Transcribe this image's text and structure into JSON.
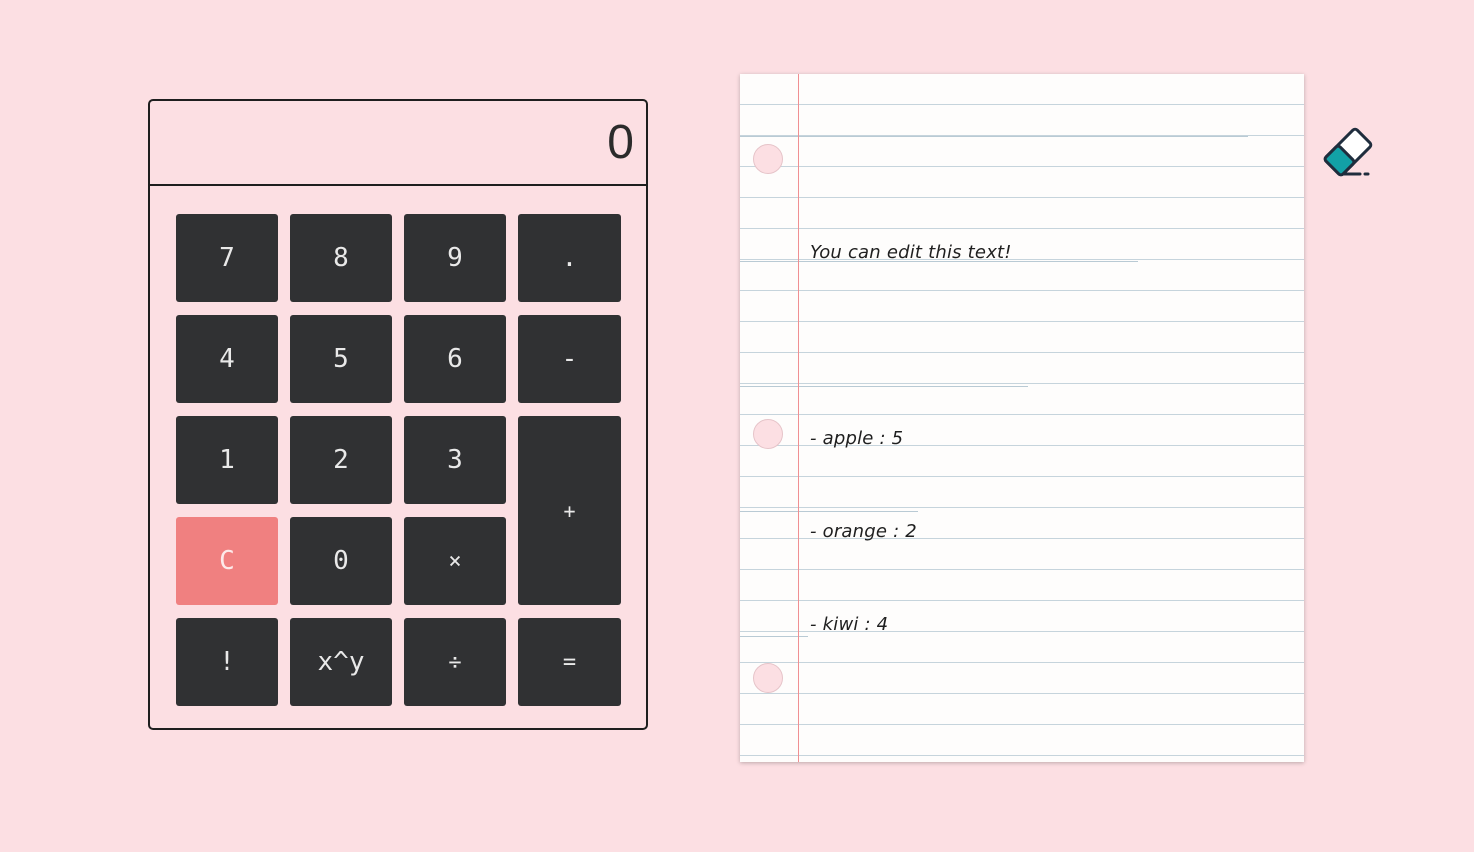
{
  "calculator": {
    "display": "0",
    "keys": [
      {
        "label": "7",
        "name": "key-7"
      },
      {
        "label": "8",
        "name": "key-8"
      },
      {
        "label": "9",
        "name": "key-9"
      },
      {
        "label": ".",
        "name": "key-decimal"
      },
      {
        "label": "4",
        "name": "key-4"
      },
      {
        "label": "5",
        "name": "key-5"
      },
      {
        "label": "6",
        "name": "key-6"
      },
      {
        "label": "-",
        "name": "key-subtract"
      },
      {
        "label": "1",
        "name": "key-1"
      },
      {
        "label": "2",
        "name": "key-2"
      },
      {
        "label": "3",
        "name": "key-3"
      },
      {
        "label": "+",
        "name": "key-add"
      },
      {
        "label": "C",
        "name": "key-clear"
      },
      {
        "label": "0",
        "name": "key-0"
      },
      {
        "label": "×",
        "name": "key-multiply"
      },
      {
        "label": "!",
        "name": "key-factorial"
      },
      {
        "label": "x^y",
        "name": "key-power"
      },
      {
        "label": "÷",
        "name": "key-divide"
      },
      {
        "label": "=",
        "name": "key-equals"
      }
    ]
  },
  "notepad": {
    "lines": [
      "You can edit this text!",
      "",
      "- apple : 5",
      "- orange : 2",
      "- kiwi : 4"
    ]
  },
  "icons": {
    "eraser": "eraser-icon"
  },
  "colors": {
    "background": "#fcdfe3",
    "key": "#303133",
    "clear_key": "#f08080",
    "eraser": "#12a1a6",
    "margin": "#f08f92"
  }
}
